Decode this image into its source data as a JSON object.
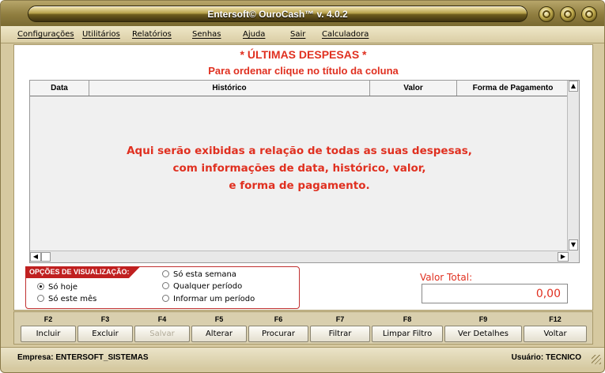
{
  "window": {
    "title": "Entersoft© OuroCash™ v. 4.0.2"
  },
  "menu": [
    {
      "label": "Configurações"
    },
    {
      "label": "Utilitários"
    },
    {
      "label": "Relatórios"
    },
    {
      "label": "Senhas"
    },
    {
      "label": "Ajuda"
    },
    {
      "label": "Sair"
    },
    {
      "label": "Calculadora"
    }
  ],
  "page": {
    "title": "* ÚLTIMAS DESPESAS *",
    "subtitle": "Para ordenar clique no título da coluna"
  },
  "table": {
    "columns": [
      "Data",
      "Histórico",
      "Valor",
      "Forma de Pagamento"
    ],
    "empty_message_lines": [
      "Aqui serão exibidas a relação de todas as suas despesas,",
      "com informações de data, histórico, valor,",
      "e forma de pagamento."
    ]
  },
  "view_options": {
    "title": "OPÇÕES DE VISUALIZAÇÃO:",
    "options": [
      {
        "label": "Só hoje",
        "selected": true
      },
      {
        "label": "Só este mês",
        "selected": false
      },
      {
        "label": "Só esta semana",
        "selected": false
      },
      {
        "label": "Qualquer período",
        "selected": false
      },
      {
        "label": "Informar um período",
        "selected": false
      }
    ]
  },
  "total": {
    "label": "Valor Total:",
    "value": "0,00"
  },
  "function_keys": [
    {
      "key": "F2",
      "label": "Incluir",
      "enabled": true
    },
    {
      "key": "F3",
      "label": "Excluir",
      "enabled": true
    },
    {
      "key": "F4",
      "label": "Salvar",
      "enabled": false
    },
    {
      "key": "F5",
      "label": "Alterar",
      "enabled": true
    },
    {
      "key": "F6",
      "label": "Procurar",
      "enabled": true
    },
    {
      "key": "F7",
      "label": "Filtrar",
      "enabled": true
    },
    {
      "key": "F8",
      "label": "Limpar Filtro",
      "enabled": true
    },
    {
      "key": "F9",
      "label": "Ver Detalhes",
      "enabled": true
    },
    {
      "key": "F12",
      "label": "Voltar",
      "enabled": true
    }
  ],
  "status": {
    "empresa": "Empresa: ENTERSOFT_SISTEMAS",
    "usuario": "Usuário: TECNICO"
  },
  "colors": {
    "accent_red": "#e03020",
    "frame_gold": "#d6c9a0"
  }
}
